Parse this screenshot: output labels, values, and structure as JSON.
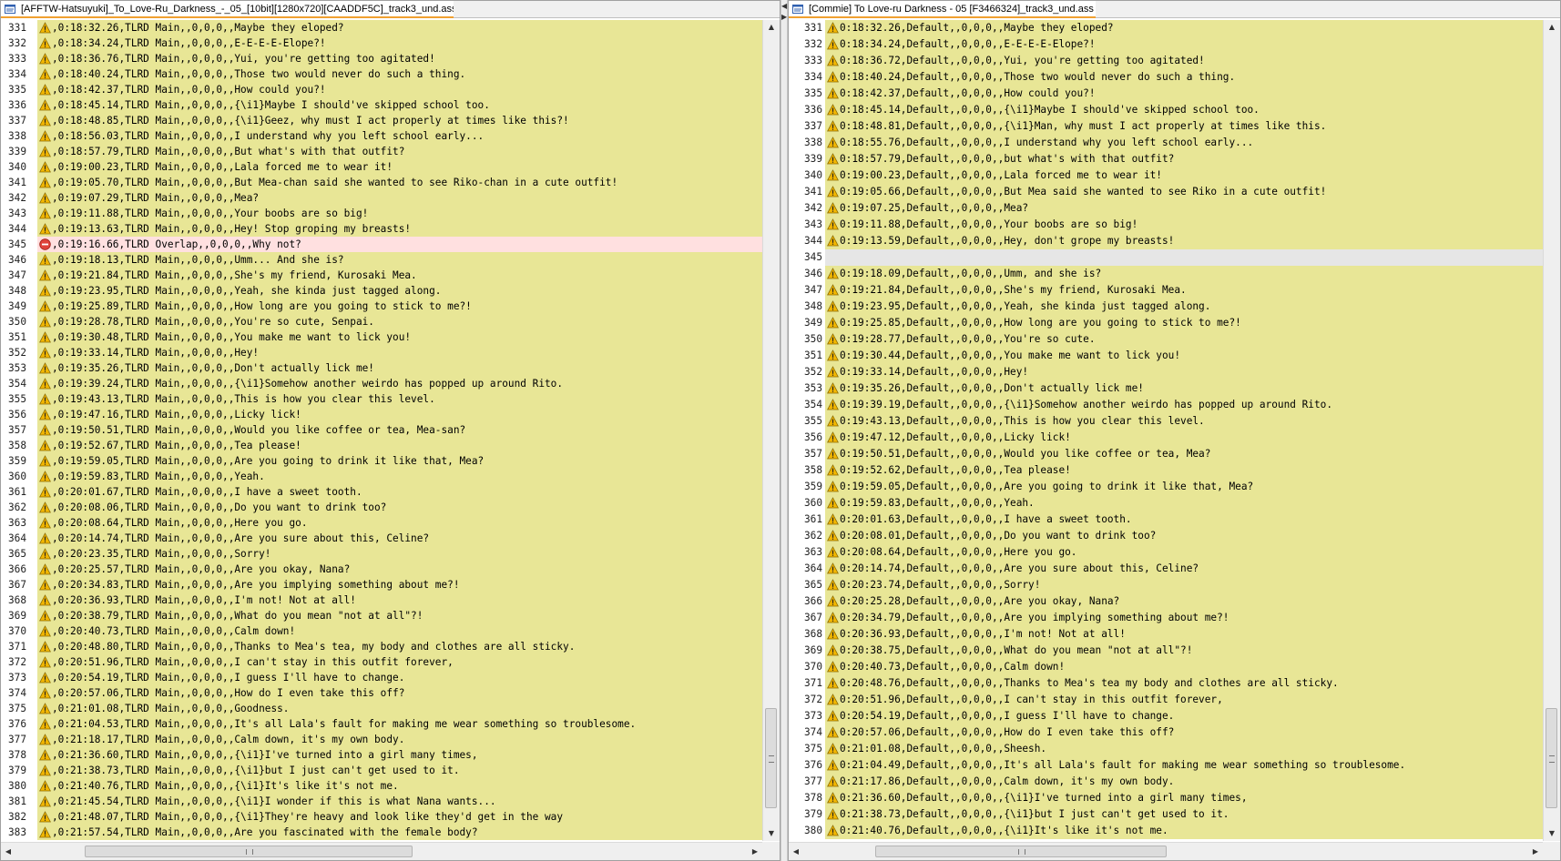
{
  "left": {
    "tab_title": "[AFFTW-Hatsuyuki]_To_Love-Ru_Darkness_-_05_[10bit][1280x720][CAADDF5C]_track3_und.ass",
    "rows": [
      {
        "n": "331",
        "s": "normal",
        "t": ",0:18:32.26,TLRD Main,,0,0,0,,Maybe they eloped?"
      },
      {
        "n": "332",
        "s": "normal",
        "t": ",0:18:34.24,TLRD Main,,0,0,0,,E-E-E-E-Elope?!"
      },
      {
        "n": "333",
        "s": "normal",
        "t": ",0:18:36.76,TLRD Main,,0,0,0,,Yui, you're getting too agitated!"
      },
      {
        "n": "334",
        "s": "normal",
        "t": ",0:18:40.24,TLRD Main,,0,0,0,,Those two would never do such a thing."
      },
      {
        "n": "335",
        "s": "normal",
        "t": ",0:18:42.37,TLRD Main,,0,0,0,,How could you?!"
      },
      {
        "n": "336",
        "s": "normal",
        "t": ",0:18:45.14,TLRD Main,,0,0,0,,{\\i1}Maybe I should've skipped school too."
      },
      {
        "n": "337",
        "s": "normal",
        "t": ",0:18:48.85,TLRD Main,,0,0,0,,{\\i1}Geez, why must I act properly at times like this?!"
      },
      {
        "n": "338",
        "s": "normal",
        "t": ",0:18:56.03,TLRD Main,,0,0,0,,I understand why you left school early..."
      },
      {
        "n": "339",
        "s": "normal",
        "t": ",0:18:57.79,TLRD Main,,0,0,0,,But what's with that outfit?"
      },
      {
        "n": "340",
        "s": "normal",
        "t": ",0:19:00.23,TLRD Main,,0,0,0,,Lala forced me to wear it!"
      },
      {
        "n": "341",
        "s": "normal",
        "t": ",0:19:05.70,TLRD Main,,0,0,0,,But Mea-chan said she wanted to see Riko-chan in a cute outfit!"
      },
      {
        "n": "342",
        "s": "normal",
        "t": ",0:19:07.29,TLRD Main,,0,0,0,,Mea?"
      },
      {
        "n": "343",
        "s": "normal",
        "t": ",0:19:11.88,TLRD Main,,0,0,0,,Your boobs are so big!"
      },
      {
        "n": "344",
        "s": "normal",
        "t": ",0:19:13.63,TLRD Main,,0,0,0,,Hey! Stop groping my breasts!"
      },
      {
        "n": "345",
        "s": "error",
        "t": ",0:19:16.66,TLRD Overlap,,0,0,0,,Why not?"
      },
      {
        "n": "346",
        "s": "normal",
        "t": ",0:19:18.13,TLRD Main,,0,0,0,,Umm... And she is?"
      },
      {
        "n": "347",
        "s": "normal",
        "t": ",0:19:21.84,TLRD Main,,0,0,0,,She's my friend, Kurosaki Mea."
      },
      {
        "n": "348",
        "s": "normal",
        "t": ",0:19:23.95,TLRD Main,,0,0,0,,Yeah, she kinda just tagged along."
      },
      {
        "n": "349",
        "s": "normal",
        "t": ",0:19:25.89,TLRD Main,,0,0,0,,How long are you going to stick to me?!"
      },
      {
        "n": "350",
        "s": "normal",
        "t": ",0:19:28.78,TLRD Main,,0,0,0,,You're so cute, Senpai."
      },
      {
        "n": "351",
        "s": "normal",
        "t": ",0:19:30.48,TLRD Main,,0,0,0,,You make me want to lick you!"
      },
      {
        "n": "352",
        "s": "normal",
        "t": ",0:19:33.14,TLRD Main,,0,0,0,,Hey!"
      },
      {
        "n": "353",
        "s": "normal",
        "t": ",0:19:35.26,TLRD Main,,0,0,0,,Don't actually lick me!"
      },
      {
        "n": "354",
        "s": "normal",
        "t": ",0:19:39.24,TLRD Main,,0,0,0,,{\\i1}Somehow another weirdo has popped up around Rito."
      },
      {
        "n": "355",
        "s": "normal",
        "t": ",0:19:43.13,TLRD Main,,0,0,0,,This is how you clear this level."
      },
      {
        "n": "356",
        "s": "normal",
        "t": ",0:19:47.16,TLRD Main,,0,0,0,,Licky lick!"
      },
      {
        "n": "357",
        "s": "normal",
        "t": ",0:19:50.51,TLRD Main,,0,0,0,,Would you like coffee or tea, Mea-san?"
      },
      {
        "n": "358",
        "s": "normal",
        "t": ",0:19:52.67,TLRD Main,,0,0,0,,Tea please!"
      },
      {
        "n": "359",
        "s": "normal",
        "t": ",0:19:59.05,TLRD Main,,0,0,0,,Are you going to drink it like that, Mea?"
      },
      {
        "n": "360",
        "s": "normal",
        "t": ",0:19:59.83,TLRD Main,,0,0,0,,Yeah."
      },
      {
        "n": "361",
        "s": "normal",
        "t": ",0:20:01.67,TLRD Main,,0,0,0,,I have a sweet tooth."
      },
      {
        "n": "362",
        "s": "normal",
        "t": ",0:20:08.06,TLRD Main,,0,0,0,,Do you want to drink too?"
      },
      {
        "n": "363",
        "s": "normal",
        "t": ",0:20:08.64,TLRD Main,,0,0,0,,Here you go."
      },
      {
        "n": "364",
        "s": "normal",
        "t": ",0:20:14.74,TLRD Main,,0,0,0,,Are you sure about this, Celine?"
      },
      {
        "n": "365",
        "s": "normal",
        "t": ",0:20:23.35,TLRD Main,,0,0,0,,Sorry!"
      },
      {
        "n": "366",
        "s": "normal",
        "t": ",0:20:25.57,TLRD Main,,0,0,0,,Are you okay, Nana?"
      },
      {
        "n": "367",
        "s": "normal",
        "t": ",0:20:34.83,TLRD Main,,0,0,0,,Are you implying something about me?!"
      },
      {
        "n": "368",
        "s": "normal",
        "t": ",0:20:36.93,TLRD Main,,0,0,0,,I'm not! Not at all!"
      },
      {
        "n": "369",
        "s": "normal",
        "t": ",0:20:38.79,TLRD Main,,0,0,0,,What do you mean \"not at all\"?!"
      },
      {
        "n": "370",
        "s": "normal",
        "t": ",0:20:40.73,TLRD Main,,0,0,0,,Calm down!"
      },
      {
        "n": "371",
        "s": "normal",
        "t": ",0:20:48.80,TLRD Main,,0,0,0,,Thanks to Mea's tea, my body and clothes are all sticky."
      },
      {
        "n": "372",
        "s": "normal",
        "t": ",0:20:51.96,TLRD Main,,0,0,0,,I can't stay in this outfit forever,"
      },
      {
        "n": "373",
        "s": "normal",
        "t": ",0:20:54.19,TLRD Main,,0,0,0,,I guess I'll have to change."
      },
      {
        "n": "374",
        "s": "normal",
        "t": ",0:20:57.06,TLRD Main,,0,0,0,,How do I even take this off?"
      },
      {
        "n": "375",
        "s": "normal",
        "t": ",0:21:01.08,TLRD Main,,0,0,0,,Goodness."
      },
      {
        "n": "376",
        "s": "normal",
        "t": ",0:21:04.53,TLRD Main,,0,0,0,,It's all Lala's fault for making me wear something so troublesome."
      },
      {
        "n": "377",
        "s": "normal",
        "t": ",0:21:18.17,TLRD Main,,0,0,0,,Calm down, it's my own body."
      },
      {
        "n": "378",
        "s": "normal",
        "t": ",0:21:36.60,TLRD Main,,0,0,0,,{\\i1}I've turned into a girl many times,"
      },
      {
        "n": "379",
        "s": "normal",
        "t": ",0:21:38.73,TLRD Main,,0,0,0,,{\\i1}but I just can't get used to it."
      },
      {
        "n": "380",
        "s": "normal",
        "t": ",0:21:40.76,TLRD Main,,0,0,0,,{\\i1}It's like it's not me."
      },
      {
        "n": "381",
        "s": "normal",
        "t": ",0:21:45.54,TLRD Main,,0,0,0,,{\\i1}I wonder if this is what Nana wants..."
      },
      {
        "n": "382",
        "s": "normal",
        "t": ",0:21:48.07,TLRD Main,,0,0,0,,{\\i1}They're heavy and look like they'd get in the way"
      },
      {
        "n": "383",
        "s": "normal",
        "t": ",0:21:57.54,TLRD Main,,0,0,0,,Are you fascinated with the female body?"
      }
    ]
  },
  "right": {
    "tab_title": "[Commie] To Love-ru Darkness - 05 [F3466324]_track3_und.ass",
    "rows": [
      {
        "n": "331",
        "s": "normal",
        "t": "0:18:32.26,Default,,0,0,0,,Maybe they eloped?"
      },
      {
        "n": "332",
        "s": "normal",
        "t": "0:18:34.24,Default,,0,0,0,,E-E-E-E-Elope?!"
      },
      {
        "n": "333",
        "s": "normal",
        "t": "0:18:36.72,Default,,0,0,0,,Yui, you're getting too agitated!"
      },
      {
        "n": "334",
        "s": "normal",
        "t": "0:18:40.24,Default,,0,0,0,,Those two would never do such a thing."
      },
      {
        "n": "335",
        "s": "normal",
        "t": "0:18:42.37,Default,,0,0,0,,How could you?!"
      },
      {
        "n": "336",
        "s": "normal",
        "t": "0:18:45.14,Default,,0,0,0,,{\\i1}Maybe I should've skipped school too."
      },
      {
        "n": "337",
        "s": "normal",
        "t": "0:18:48.81,Default,,0,0,0,,{\\i1}Man, why must I act properly at times like this."
      },
      {
        "n": "338",
        "s": "normal",
        "t": "0:18:55.76,Default,,0,0,0,,I understand why you left school early..."
      },
      {
        "n": "339",
        "s": "normal",
        "t": "0:18:57.79,Default,,0,0,0,,but what's with that outfit?"
      },
      {
        "n": "340",
        "s": "normal",
        "t": "0:19:00.23,Default,,0,0,0,,Lala forced me to wear it!"
      },
      {
        "n": "341",
        "s": "normal",
        "t": "0:19:05.66,Default,,0,0,0,,But Mea said she wanted to see Riko in a cute outfit!"
      },
      {
        "n": "342",
        "s": "normal",
        "t": "0:19:07.25,Default,,0,0,0,,Mea?"
      },
      {
        "n": "343",
        "s": "normal",
        "t": "0:19:11.88,Default,,0,0,0,,Your boobs are so big!"
      },
      {
        "n": "344",
        "s": "normal",
        "t": "0:19:13.59,Default,,0,0,0,,Hey, don't grope my breasts!"
      },
      {
        "n": "345",
        "s": "empty",
        "t": ""
      },
      {
        "n": "346",
        "s": "normal",
        "t": "0:19:18.09,Default,,0,0,0,,Umm, and she is?"
      },
      {
        "n": "347",
        "s": "normal",
        "t": "0:19:21.84,Default,,0,0,0,,She's my friend, Kurosaki Mea."
      },
      {
        "n": "348",
        "s": "normal",
        "t": "0:19:23.95,Default,,0,0,0,,Yeah, she kinda just tagged along."
      },
      {
        "n": "349",
        "s": "normal",
        "t": "0:19:25.85,Default,,0,0,0,,How long are you going to stick to me?!"
      },
      {
        "n": "350",
        "s": "normal",
        "t": "0:19:28.77,Default,,0,0,0,,You're so cute."
      },
      {
        "n": "351",
        "s": "normal",
        "t": "0:19:30.44,Default,,0,0,0,,You make me want to lick you!"
      },
      {
        "n": "352",
        "s": "normal",
        "t": "0:19:33.14,Default,,0,0,0,,Hey!"
      },
      {
        "n": "353",
        "s": "normal",
        "t": "0:19:35.26,Default,,0,0,0,,Don't actually lick me!"
      },
      {
        "n": "354",
        "s": "normal",
        "t": "0:19:39.19,Default,,0,0,0,,{\\i1}Somehow another weirdo has popped up around Rito."
      },
      {
        "n": "355",
        "s": "normal",
        "t": "0:19:43.13,Default,,0,0,0,,This is how you clear this level."
      },
      {
        "n": "356",
        "s": "normal",
        "t": "0:19:47.12,Default,,0,0,0,,Licky lick!"
      },
      {
        "n": "357",
        "s": "normal",
        "t": "0:19:50.51,Default,,0,0,0,,Would you like coffee or tea, Mea?"
      },
      {
        "n": "358",
        "s": "normal",
        "t": "0:19:52.62,Default,,0,0,0,,Tea please!"
      },
      {
        "n": "359",
        "s": "normal",
        "t": "0:19:59.05,Default,,0,0,0,,Are you going to drink it like that, Mea?"
      },
      {
        "n": "360",
        "s": "normal",
        "t": "0:19:59.83,Default,,0,0,0,,Yeah."
      },
      {
        "n": "361",
        "s": "normal",
        "t": "0:20:01.63,Default,,0,0,0,,I have a sweet tooth."
      },
      {
        "n": "362",
        "s": "normal",
        "t": "0:20:08.01,Default,,0,0,0,,Do you want to drink too?"
      },
      {
        "n": "363",
        "s": "normal",
        "t": "0:20:08.64,Default,,0,0,0,,Here you go."
      },
      {
        "n": "364",
        "s": "normal",
        "t": "0:20:14.74,Default,,0,0,0,,Are you sure about this, Celine?"
      },
      {
        "n": "365",
        "s": "normal",
        "t": "0:20:23.74,Default,,0,0,0,,Sorry!"
      },
      {
        "n": "366",
        "s": "normal",
        "t": "0:20:25.28,Default,,0,0,0,,Are you okay, Nana?"
      },
      {
        "n": "367",
        "s": "normal",
        "t": "0:20:34.79,Default,,0,0,0,,Are you implying something about me?!"
      },
      {
        "n": "368",
        "s": "normal",
        "t": "0:20:36.93,Default,,0,0,0,,I'm not! Not at all!"
      },
      {
        "n": "369",
        "s": "normal",
        "t": "0:20:38.75,Default,,0,0,0,,What do you mean \"not at all\"?!"
      },
      {
        "n": "370",
        "s": "normal",
        "t": "0:20:40.73,Default,,0,0,0,,Calm down!"
      },
      {
        "n": "371",
        "s": "normal",
        "t": "0:20:48.76,Default,,0,0,0,,Thanks to Mea's tea my body and clothes are all sticky."
      },
      {
        "n": "372",
        "s": "normal",
        "t": "0:20:51.96,Default,,0,0,0,,I can't stay in this outfit forever,"
      },
      {
        "n": "373",
        "s": "normal",
        "t": "0:20:54.19,Default,,0,0,0,,I guess I'll have to change."
      },
      {
        "n": "374",
        "s": "normal",
        "t": "0:20:57.06,Default,,0,0,0,,How do I even take this off?"
      },
      {
        "n": "375",
        "s": "normal",
        "t": "0:21:01.08,Default,,0,0,0,,Sheesh."
      },
      {
        "n": "376",
        "s": "normal",
        "t": "0:21:04.49,Default,,0,0,0,,It's all Lala's fault for making me wear something so troublesome."
      },
      {
        "n": "377",
        "s": "normal",
        "t": "0:21:17.86,Default,,0,0,0,,Calm down, it's my own body."
      },
      {
        "n": "378",
        "s": "normal",
        "t": "0:21:36.60,Default,,0,0,0,,{\\i1}I've turned into a girl many times,"
      },
      {
        "n": "379",
        "s": "normal",
        "t": "0:21:38.73,Default,,0,0,0,,{\\i1}but I just can't get used to it."
      },
      {
        "n": "380",
        "s": "normal",
        "t": "0:21:40.76,Default,,0,0,0,,{\\i1}It's like it's not me."
      }
    ]
  }
}
